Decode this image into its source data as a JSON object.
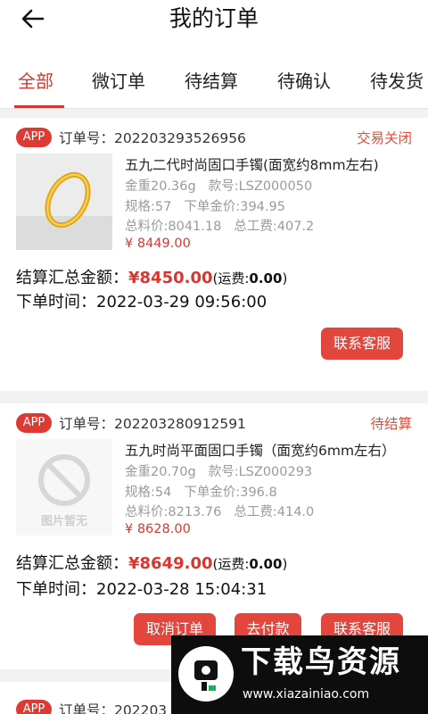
{
  "header": {
    "title": "我的订单"
  },
  "tabs": [
    {
      "label": "全部",
      "active": true
    },
    {
      "label": "微订单",
      "active": false
    },
    {
      "label": "待结算",
      "active": false
    },
    {
      "label": "待确认",
      "active": false
    },
    {
      "label": "待发货",
      "active": false
    }
  ],
  "colors": {
    "accent": "#d9362f",
    "button": "#e2463d",
    "badge": "#dd3a33"
  },
  "orders": [
    {
      "badge": "APP",
      "order_no": "订单号：202203293526956",
      "status": "交易关闭",
      "product": {
        "name": "五九二代时尚固口手镯(面宽约8mm左右)",
        "weight": "金重20.36g",
        "sku": "款号:LSZ000050",
        "spec": "规格:57",
        "unit_price": "下单金价:394.95",
        "material_price": "总料价:8041.18",
        "labor_fee": "总工费:407.2",
        "price": "¥ 8449.00",
        "image": "gold-bangle-photo"
      },
      "summary_label": "结算汇总金额：",
      "summary_amount": "¥8450.00",
      "shipping_label": "(运费:",
      "shipping_value": "0.00",
      "shipping_close": ")",
      "time": "下单时间：2022-03-29 09:56:00",
      "buttons": [
        "联系客服"
      ]
    },
    {
      "badge": "APP",
      "order_no": "订单号：202203280912591",
      "status": "待结算",
      "product": {
        "name": "五九时尚平面固口手镯（面宽约6mm左右）",
        "weight": "金重20.70g",
        "sku": "款号:LSZ000293",
        "spec": "规格:54",
        "unit_price": "下单金价:396.8",
        "material_price": "总料价:8213.76",
        "labor_fee": "总工费:414.0",
        "price": "¥ 8628.00",
        "image_text": "图片暂无",
        "image": "no-image-placeholder"
      },
      "summary_label": "结算汇总金额：",
      "summary_amount": "¥8649.00",
      "shipping_label": "(运费:",
      "shipping_value": "0.00",
      "shipping_close": ")",
      "time": "下单时间：2022-03-28 15:04:31",
      "buttons": [
        "取消订单",
        "去付款",
        "联系客服"
      ]
    },
    {
      "badge": "APP",
      "order_no": "订单号：202203",
      "status": "待"
    }
  ],
  "watermark": {
    "title": "下载鸟资源",
    "url": "www.xiazainiao.com"
  }
}
